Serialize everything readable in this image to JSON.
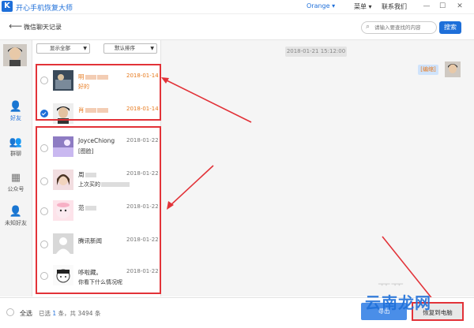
{
  "app": {
    "logo_letter": "K",
    "title": "开心手机恢复大师",
    "user": "Orange ▾",
    "menu": "菜单 ▾",
    "contact": "联系我们",
    "win_min": "—",
    "win_max": "☐",
    "win_close": "✕"
  },
  "header": {
    "back": "⟵",
    "title": "微信聊天记录",
    "search_placeholder": "请输入要查找的内容",
    "search_button": "搜索"
  },
  "nav": {
    "items": [
      {
        "icon": "👤",
        "label": "好友",
        "active": true
      },
      {
        "icon": "👥",
        "label": "群聊"
      },
      {
        "icon": "▦",
        "label": "公众号"
      },
      {
        "icon": "👤",
        "label": "未知好友"
      }
    ]
  },
  "filters": {
    "show_all": "显示全部",
    "sort": "默认排序"
  },
  "contacts": [
    {
      "name": "明",
      "date": "2018-01-14",
      "message": "好的",
      "highlight": true,
      "checked": false
    },
    {
      "name": "肖",
      "date": "2018-01-14",
      "message": "",
      "highlight": true,
      "checked": true
    },
    {
      "name": "JoyceChiong",
      "date": "2018-01-22",
      "message": "[图脸]",
      "highlight": false,
      "checked": false
    },
    {
      "name": "周",
      "date": "2018-01-22",
      "message": "上次买的",
      "highlight": false,
      "checked": false
    },
    {
      "name": "范",
      "date": "2018-01-22",
      "message": "",
      "highlight": false,
      "checked": false
    },
    {
      "name": "腾讯新闻",
      "date": "2018-01-22",
      "message": "",
      "highlight": false,
      "checked": false
    },
    {
      "name": "哆啦藏。",
      "date": "2018-01-22",
      "message": "你看下什么情况呢",
      "highlight": false,
      "checked": false
    }
  ],
  "chat": {
    "timestamp": "2018-01-21 15:12:00",
    "bubble": "[编缩]"
  },
  "footer": {
    "select_all": "全选",
    "selected_prefix": "已选",
    "selected_count": "1",
    "selected_mid": "条，共",
    "total": "3494",
    "unit": "条",
    "btn_export": "导出",
    "btn_recover": "恢复到电脑"
  },
  "watermark": {
    "text": "云南龙网",
    "ghost": "ᅲᅲ"
  },
  "colors": {
    "accent": "#1e6fd9",
    "highlight_text": "#e77a1e",
    "annotation": "#e23238"
  }
}
